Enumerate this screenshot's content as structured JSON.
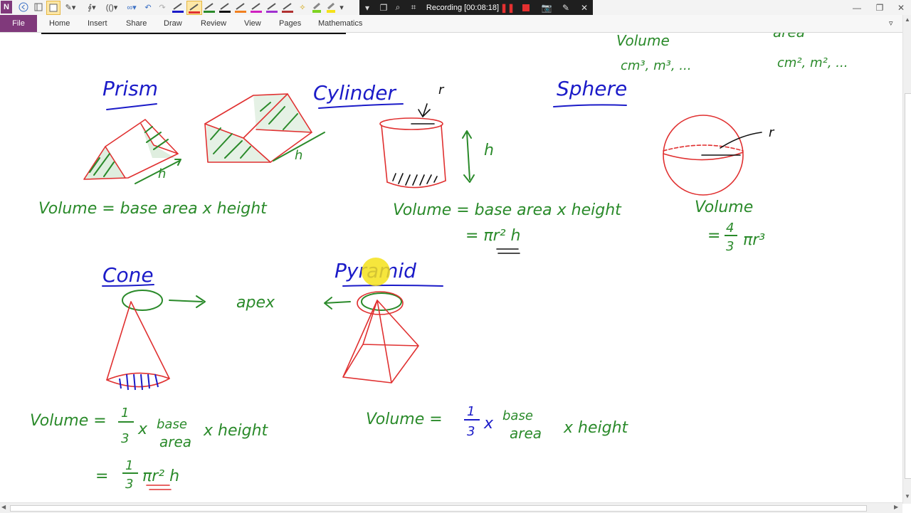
{
  "app": {
    "logo_letter": "N"
  },
  "recording": {
    "label": "Recording [00:08:18]"
  },
  "ribbon": {
    "file": "File",
    "tabs": [
      "Home",
      "Insert",
      "Share",
      "Draw",
      "Review",
      "View",
      "Pages",
      "Mathematics"
    ]
  },
  "colors": {
    "ink_green": "#2a8a2a",
    "ink_red": "#e03030",
    "ink_blue": "#1b1bc8",
    "ink_black": "#111111",
    "cursor_highlight": "#f5e21a",
    "file_tab": "#80397b"
  },
  "notes": {
    "top_right": {
      "volume_label": "Volume",
      "volume_units": "cm³, m³, ...",
      "area_label": "area",
      "area_units": "cm², m², ..."
    },
    "prism": {
      "title": "Prism",
      "h": "h",
      "formula": "Volume  =  base  area  x  height"
    },
    "cylinder": {
      "title": "Cylinder",
      "r": "r",
      "h": "h",
      "formula": "Volume  = base area x height",
      "formula2": "= πr² h"
    },
    "sphere": {
      "title": "Sphere",
      "r": "r",
      "formula": "Volume",
      "formula2_prefix": "=",
      "frac_num": "4",
      "frac_den": "3",
      "formula2_suffix": "πr³"
    },
    "cone": {
      "title": "Cone",
      "apex": "apex",
      "formula_prefix": "Volume  =",
      "frac_num": "1",
      "frac_den": "3",
      "x": "x",
      "base": "base",
      "area": "area",
      "rest": "x height",
      "formula2_prefix": "=",
      "formula2_suffix": "πr² h"
    },
    "pyramid": {
      "title": "Pyramid",
      "formula_prefix": "Volume =",
      "frac_num": "1",
      "frac_den": "3",
      "x": "x",
      "base": "base",
      "area": "area",
      "rest": "x  height"
    }
  }
}
